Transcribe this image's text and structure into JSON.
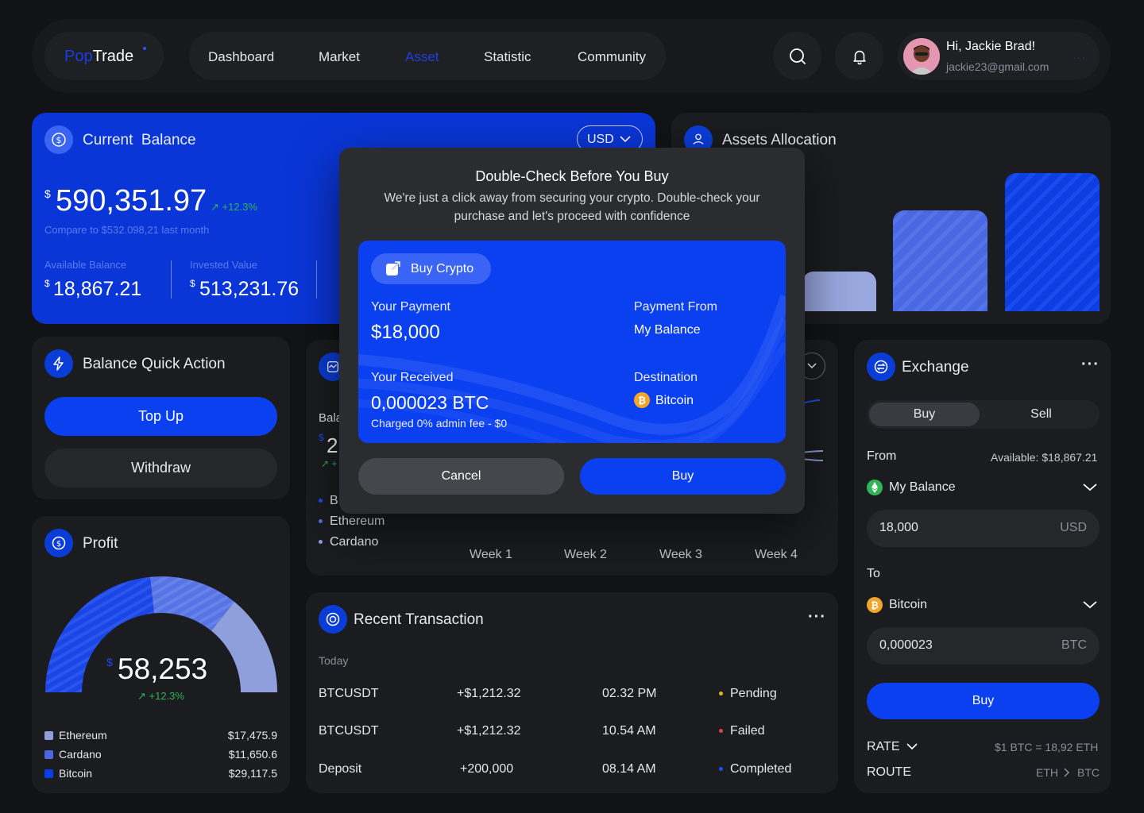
{
  "header": {
    "logo_pop": "Pop",
    "logo_trade": "Trade",
    "nav": [
      "Dashboard",
      "Market",
      "Asset",
      "Statistic",
      "Community"
    ],
    "active_nav": "Asset",
    "greeting": "Hi, Jackie Brad!",
    "email": "jackie23@gmail.com",
    "icons": [
      "search-icon",
      "bell-icon"
    ]
  },
  "balance": {
    "title": "Current  Balance",
    "currency": "USD",
    "currency_symbol": "$",
    "amount": "590,351.97",
    "change": "+12.3%",
    "compare": "Compare to $532.098,21 last month",
    "available_label": "Available Balance",
    "available_value": "18,867.21",
    "invested_label": "Invested Value",
    "invested_value": "513,231.76"
  },
  "allocation": {
    "title": "Assets Allocation"
  },
  "quick_action": {
    "title": "Balance Quick Action",
    "top_up": "Top Up",
    "withdraw": "Withdraw"
  },
  "middle_chart": {
    "partial_label": "Bala",
    "partial_symbol": "$",
    "partial_value": "2",
    "partial_change": "↗ +",
    "legend_partial": "B",
    "legend": [
      "Ethereum",
      "Cardano"
    ],
    "weeks": [
      "Week 1",
      "Week 2",
      "Week 3",
      "Week 4"
    ]
  },
  "profit": {
    "title": "Profit",
    "symbol": "$",
    "amount": "58,253",
    "change": "+12.3%",
    "legend": [
      {
        "name": "Ethereum",
        "value": "$17,475.9",
        "color": "#8e9fdc"
      },
      {
        "name": "Cardano",
        "value": "$11,650.6",
        "color": "#4a66e0"
      },
      {
        "name": "Bitcoin",
        "value": "$29,117.5",
        "color": "#0a3de6"
      }
    ]
  },
  "transactions": {
    "title": "Recent Transaction",
    "section": "Today",
    "rows": [
      {
        "name": "BTCUSDT",
        "amount": "+$1,212.32",
        "time": "02.32 PM",
        "status": "Pending",
        "status_color": "#e6b422",
        "amount_green": true
      },
      {
        "name": "BTCUSDT",
        "amount": "+$1,212.32",
        "time": "10.54 AM",
        "status": "Failed",
        "status_color": "#e0453a",
        "amount_green": false
      },
      {
        "name": "Deposit",
        "amount": "+200,000",
        "time": "08.14 AM",
        "status": "Completed",
        "status_color": "#1a4ff5",
        "amount_green": true
      }
    ]
  },
  "exchange": {
    "title": "Exchange",
    "tab_buy": "Buy",
    "tab_sell": "Sell",
    "from_label": "From",
    "available": "Available: $18,867.21",
    "from_asset": "My Balance",
    "from_amount": "18,000",
    "from_currency": "USD",
    "to_label": "To",
    "to_asset": "Bitcoin",
    "to_amount": "0,000023",
    "to_currency": "BTC",
    "buy_button": "Buy",
    "rate_label": "RATE",
    "rate_value": "$1 BTC = 18,92 ETH",
    "route_label": "ROUTE",
    "route_from": "ETH",
    "route_to": "BTC"
  },
  "modal": {
    "title": "Double-Check Before You Buy",
    "subtitle_line1": "We're just a click away from securing your crypto. Double-check your",
    "subtitle_line2": "purchase and let's proceed with confidence",
    "chip": "Buy Crypto",
    "payment_label": "Your Payment",
    "payment_value": "$18,000",
    "from_label": "Payment From",
    "from_value": "My Balance",
    "received_label": "Your Received",
    "received_value": "0,000023 BTC",
    "fee": "Charged 0% admin fee - $0",
    "dest_label": "Destination",
    "dest_value": "Bitcoin",
    "cancel": "Cancel",
    "buy": "Buy"
  }
}
